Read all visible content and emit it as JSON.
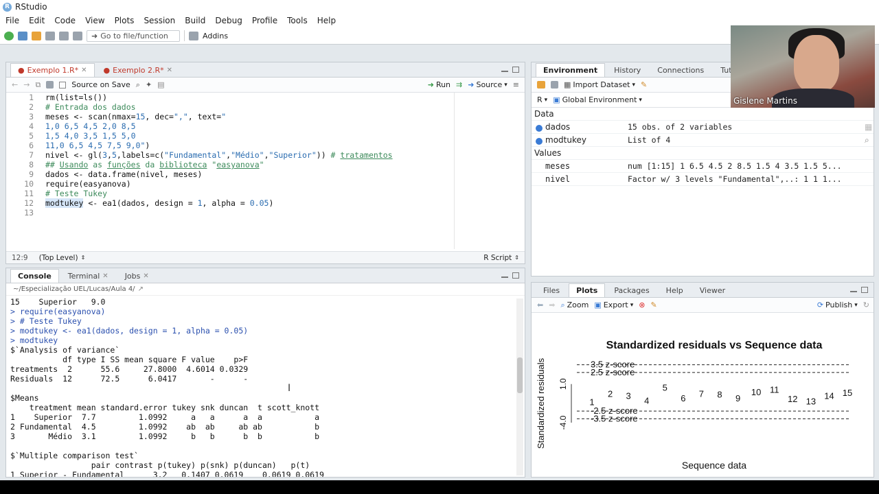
{
  "window": {
    "title": "RStudio"
  },
  "menu": [
    "File",
    "Edit",
    "Code",
    "View",
    "Plots",
    "Session",
    "Build",
    "Debug",
    "Profile",
    "Tools",
    "Help"
  ],
  "toolbar": {
    "goto_placeholder": "Go to file/function",
    "addins": "Addins"
  },
  "editor": {
    "tabs": [
      {
        "label": "Exemplo 1.R*"
      },
      {
        "label": "Exemplo 2.R*"
      }
    ],
    "source_on_save": "Source on Save",
    "run": "Run",
    "source": "Source",
    "status_position": "12:9",
    "status_scope": "(Top Level)",
    "status_type": "R Script",
    "line_numbers": [
      "1",
      "2",
      "3",
      "4",
      "5",
      "6",
      "7",
      "8",
      "9",
      "10",
      "11",
      "12",
      "13"
    ]
  },
  "console_pane": {
    "tabs": [
      "Console",
      "Terminal",
      "Jobs"
    ],
    "path": "~/Especialização UEL/Lucas/Aula 4/"
  },
  "env_pane": {
    "tabs": [
      "Environment",
      "History",
      "Connections",
      "Tutorial"
    ],
    "import_dataset": "Import Dataset",
    "language": "R",
    "scope": "Global Environment",
    "data_header": "Data",
    "values_header": "Values",
    "data": [
      {
        "name": "dados",
        "value": "15 obs. of 2 variables"
      },
      {
        "name": "modtukey",
        "value": "List of  4"
      }
    ],
    "values": [
      {
        "name": "meses",
        "value": "num [1:15] 1 6.5 4.5 2 8.5 1.5 4 3.5 1.5 5..."
      },
      {
        "name": "nivel",
        "value": "Factor w/ 3 levels \"Fundamental\",..: 1 1 1..."
      }
    ]
  },
  "files_pane": {
    "tabs": [
      "Files",
      "Plots",
      "Packages",
      "Help",
      "Viewer"
    ],
    "zoom": "Zoom",
    "export": "Export",
    "publish": "Publish"
  },
  "chart_data": {
    "type": "scatter",
    "title": "Standardized residuals vs Sequence data",
    "xlabel": "Sequence data",
    "ylabel": "Standardized residuals",
    "ytick_labels": [
      "1.0",
      "-4.0"
    ],
    "x": [
      1,
      2,
      3,
      4,
      5,
      6,
      7,
      8,
      9,
      10,
      11,
      12,
      13,
      14,
      15
    ],
    "y": [
      -1.3,
      -0.2,
      -0.5,
      -1.1,
      0.6,
      -0.8,
      -0.2,
      -0.3,
      -0.8,
      0.0,
      0.3,
      -0.9,
      -1.2,
      -0.5,
      -0.1
    ],
    "reference_lines": [
      {
        "label": "3.5 z-score",
        "y": 3.5
      },
      {
        "label": "2.5 z-score",
        "y": 2.5
      },
      {
        "label": "-2.5 z-score",
        "y": -2.5
      },
      {
        "label": "-3.5 z-score",
        "y": -3.5
      }
    ],
    "point_style": "labels",
    "grid": false
  },
  "webcam": {
    "name": "Gislene Martins"
  }
}
